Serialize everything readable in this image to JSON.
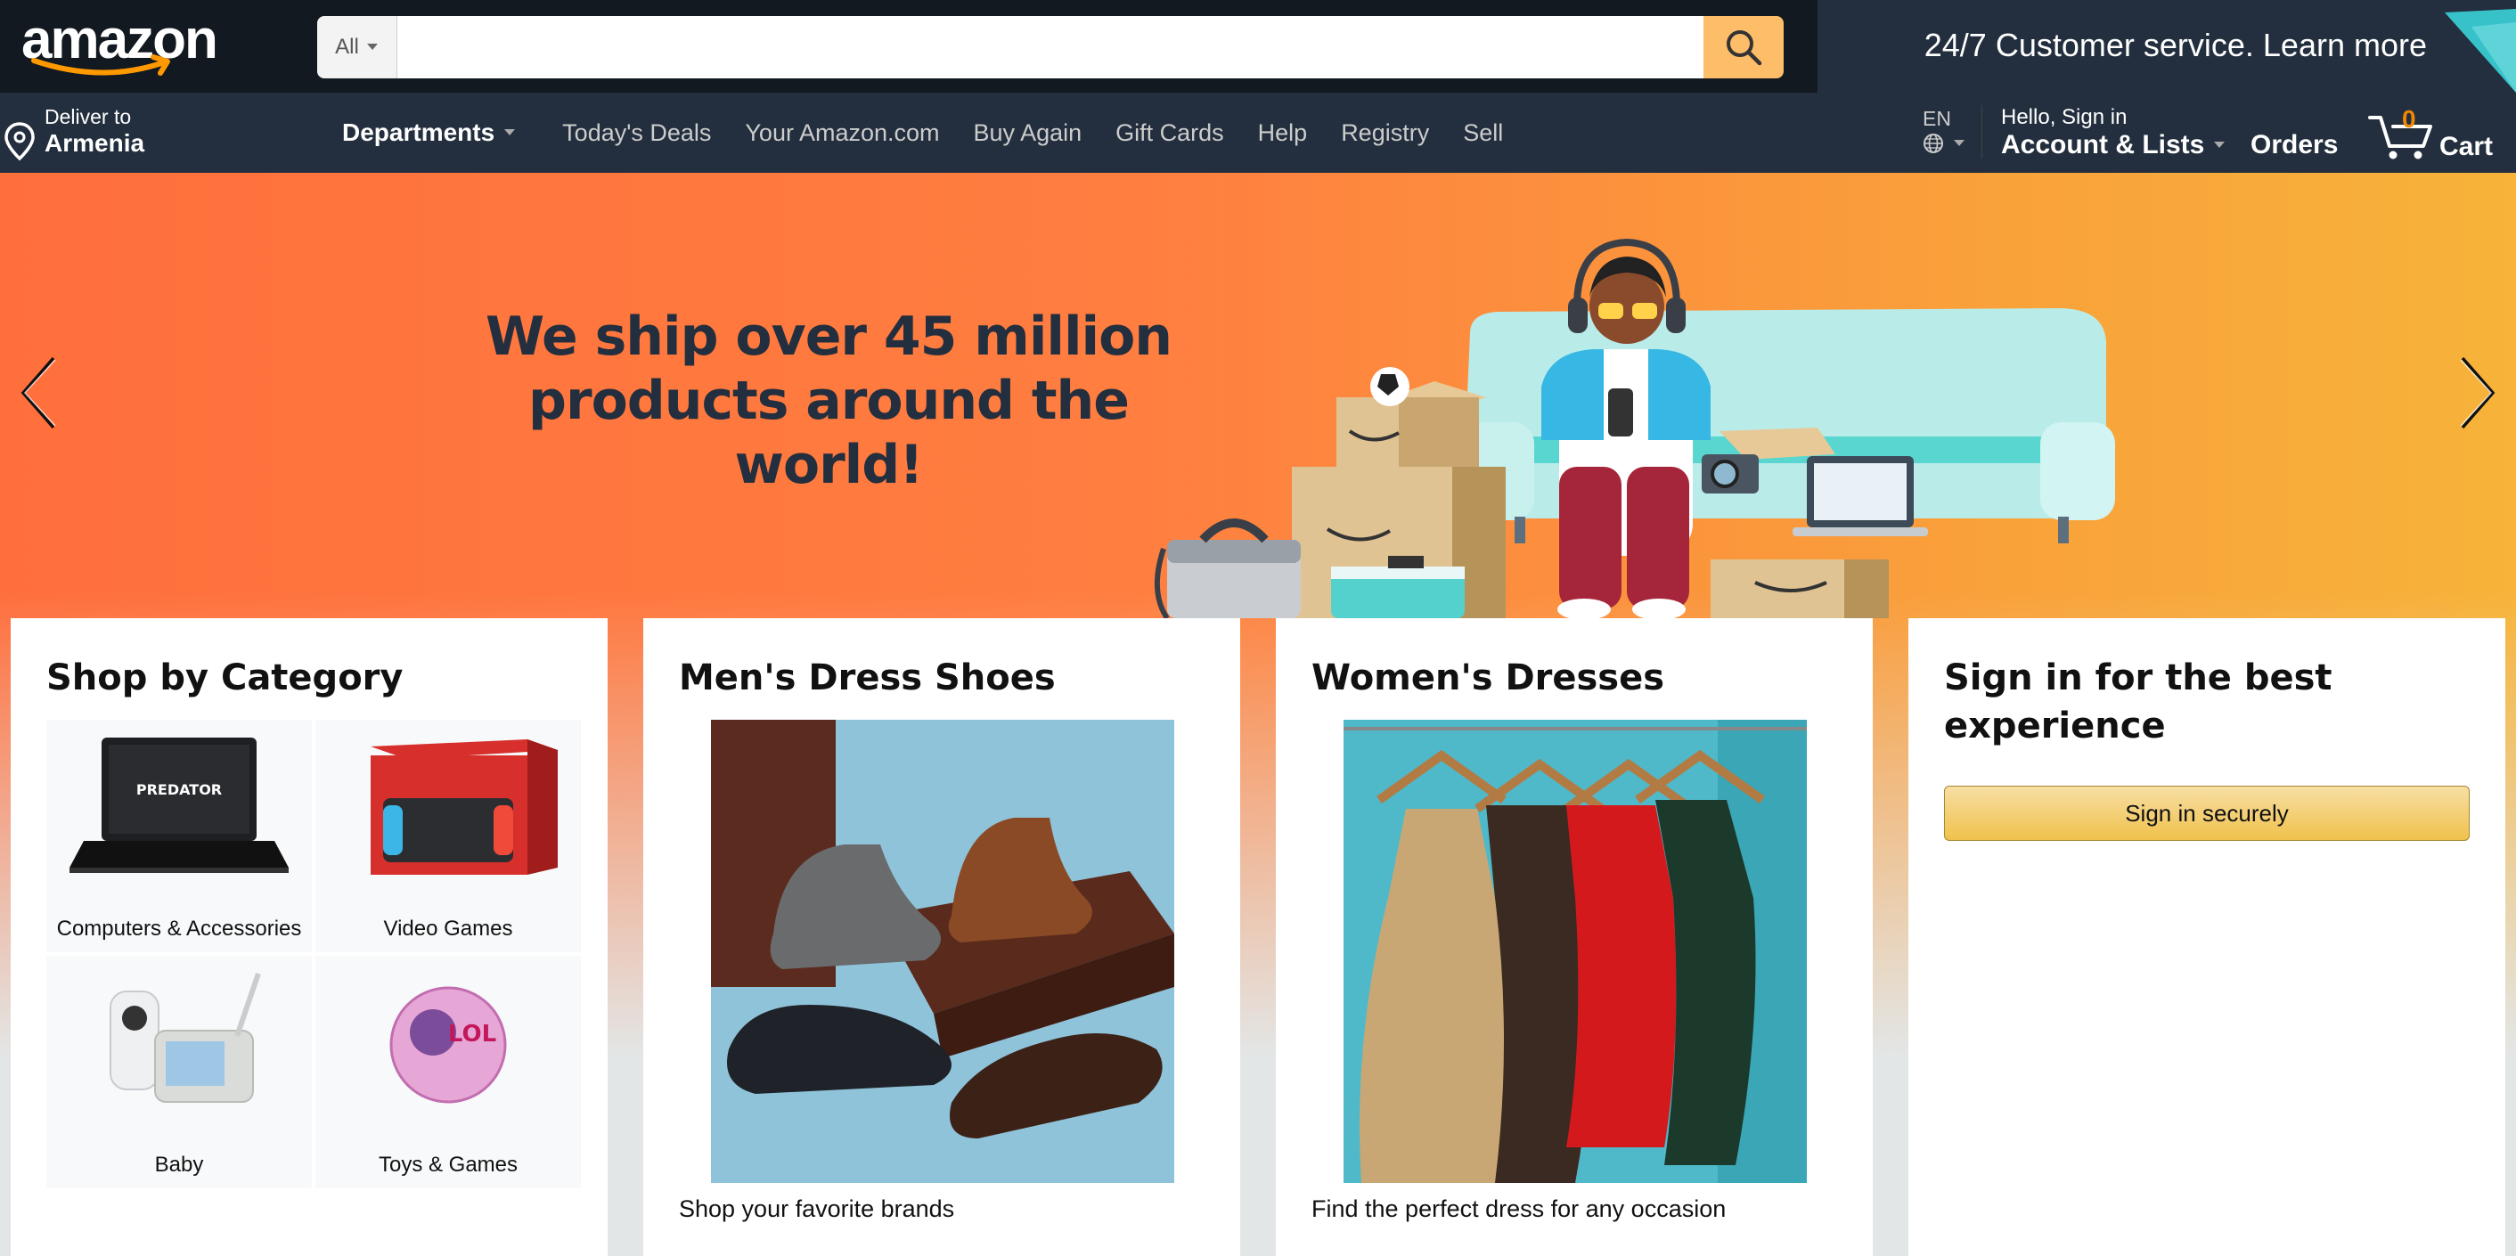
{
  "header": {
    "logo_text": "amazon",
    "search": {
      "department": "All",
      "value": "",
      "placeholder": ""
    },
    "promo_text": "24/7 Customer service. Learn more"
  },
  "nav": {
    "deliver_line1": "Deliver to",
    "deliver_line2": "Armenia",
    "departments_label": "Departments",
    "links": [
      "Today's Deals",
      "Your Amazon.com",
      "Buy Again",
      "Gift Cards",
      "Help",
      "Registry",
      "Sell"
    ],
    "language": "EN",
    "account_line1": "Hello, Sign in",
    "account_line2": "Account & Lists",
    "orders": "Orders",
    "cart_count": "0",
    "cart_label": "Cart"
  },
  "hero": {
    "headline_line1": "We ship over 45 million",
    "headline_line2": "products around the world!"
  },
  "cards": {
    "category": {
      "title": "Shop by Category",
      "tiles": [
        {
          "label": "Computers & Accessories"
        },
        {
          "label": "Video Games"
        },
        {
          "label": "Baby"
        },
        {
          "label": "Toys & Games"
        }
      ]
    },
    "shoes": {
      "title": "Men's Dress Shoes",
      "caption": "Shop your favorite brands"
    },
    "dresses": {
      "title": "Women's Dresses",
      "caption": "Find the perfect dress for any occasion"
    },
    "signin": {
      "title_line1": "Sign in for the best",
      "title_line2": "experience",
      "button": "Sign in securely"
    }
  },
  "colors": {
    "topbar": "#131921",
    "navbar": "#232f3e",
    "search_button": "#febd69",
    "cart_count": "#f08804",
    "hero_left": "#ff6f3c",
    "hero_right": "#f7b33a"
  }
}
